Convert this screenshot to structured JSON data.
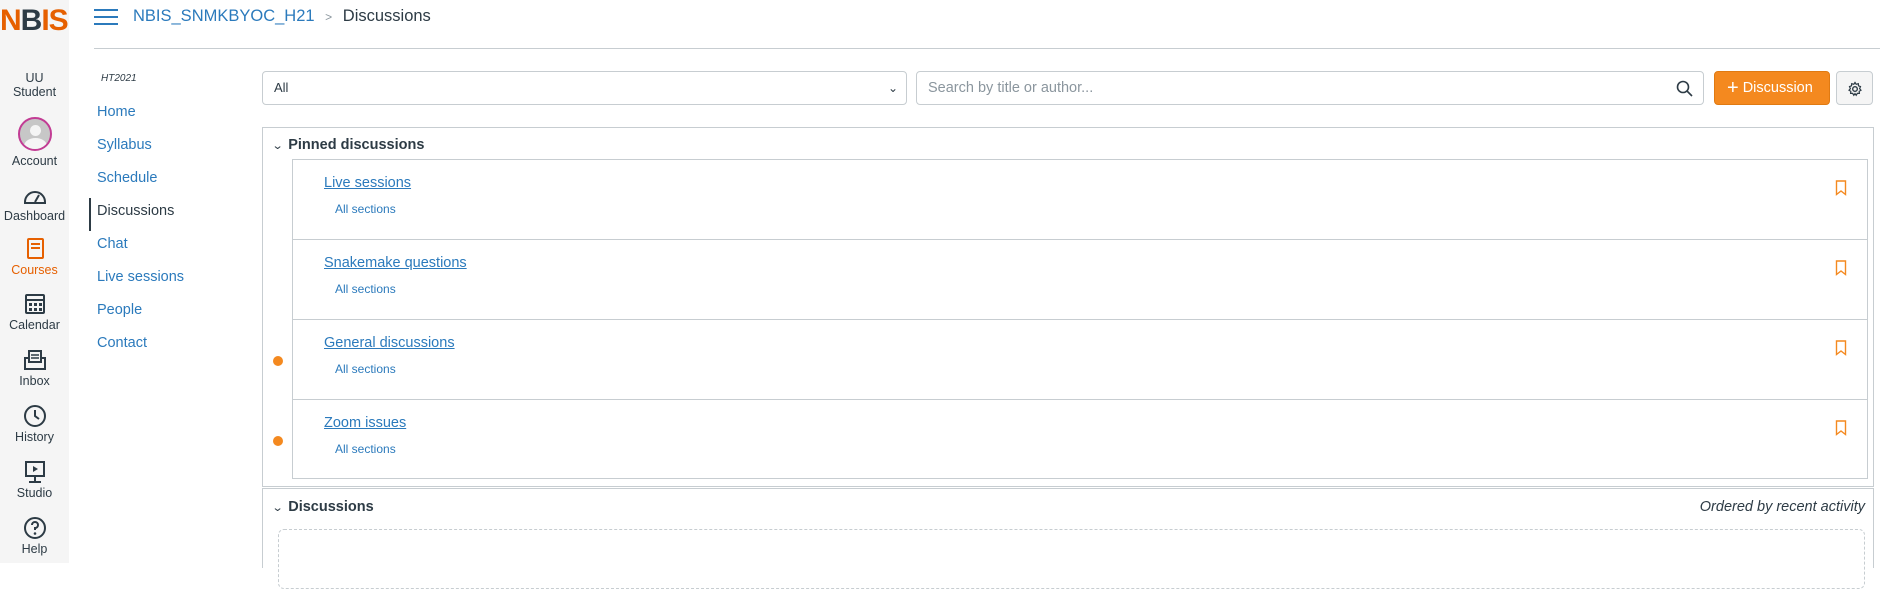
{
  "global_nav": {
    "logo": "NBIS",
    "items": [
      {
        "label": "UU\nStudent",
        "icon": "account-name"
      },
      {
        "label": "Account",
        "icon": "avatar"
      },
      {
        "label": "Dashboard",
        "icon": "dashboard-icon"
      },
      {
        "label": "Courses",
        "icon": "courses-icon"
      },
      {
        "label": "Calendar",
        "icon": "calendar-icon"
      },
      {
        "label": "Inbox",
        "icon": "inbox-icon"
      },
      {
        "label": "History",
        "icon": "history-icon"
      },
      {
        "label": "Studio",
        "icon": "studio-icon"
      },
      {
        "label": "Help",
        "icon": "help-icon"
      }
    ],
    "user_line1": "UU",
    "user_line2": "Student"
  },
  "header": {
    "course": "NBIS_SNMKBYOC_H21",
    "separator": ">",
    "current": "Discussions"
  },
  "course_nav": {
    "term": "HT2021",
    "items": [
      "Home",
      "Syllabus",
      "Schedule",
      "Discussions",
      "Chat",
      "Live sessions",
      "People",
      "Contact"
    ],
    "active": "Discussions"
  },
  "toolbar": {
    "filter_value": "All",
    "search_placeholder": "Search by title or author...",
    "new_button": "Discussion"
  },
  "pinned": {
    "heading": "Pinned discussions",
    "items": [
      {
        "title": "Live sessions",
        "sections": "All sections",
        "unread": false
      },
      {
        "title": "Snakemake questions",
        "sections": "All sections",
        "unread": false
      },
      {
        "title": "General discussions",
        "sections": "All sections",
        "unread": true
      },
      {
        "title": "Zoom issues",
        "sections": "All sections",
        "unread": true
      }
    ]
  },
  "discussions": {
    "heading": "Discussions",
    "order_note": "Ordered by recent activity"
  },
  "colors": {
    "accent": "#f4891f",
    "link": "#2b7abc",
    "text": "#2d3b45"
  }
}
